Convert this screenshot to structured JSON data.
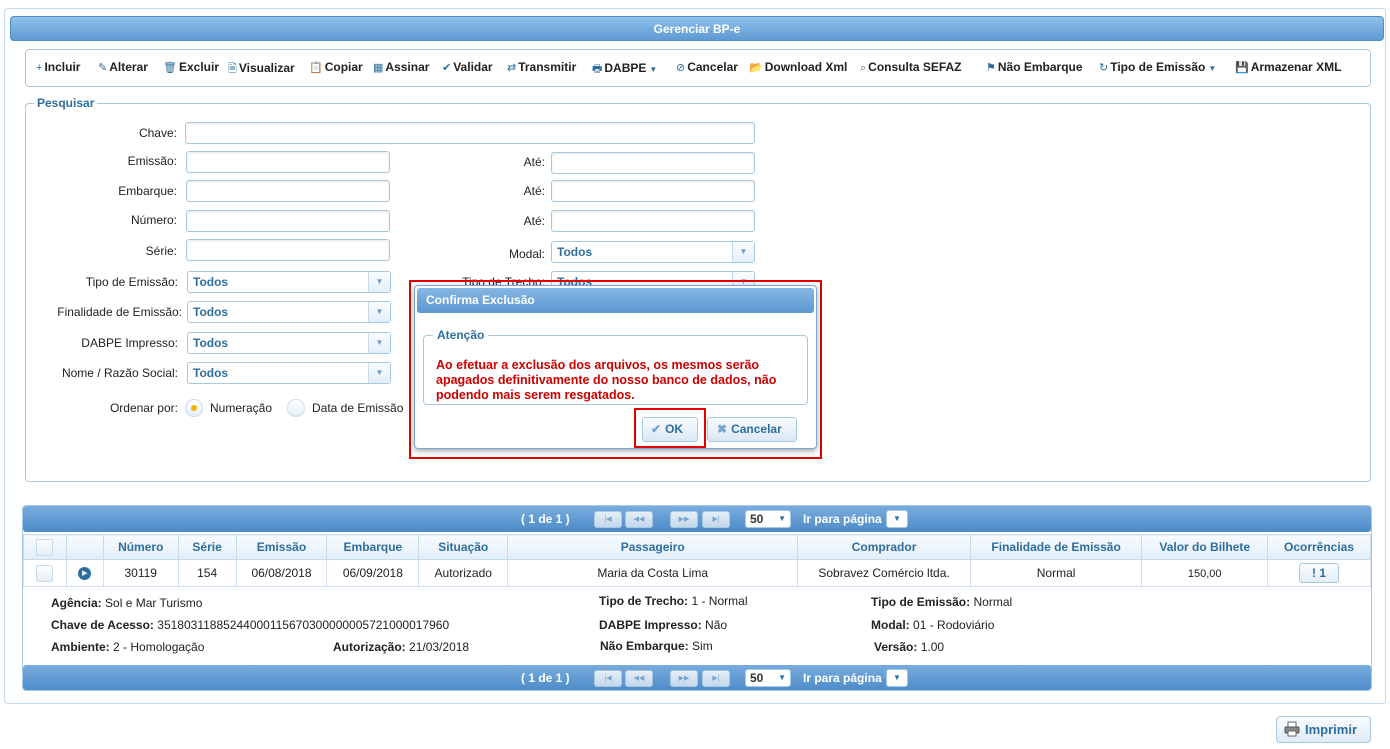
{
  "window": {
    "title": "Gerenciar BP-e"
  },
  "toolbar": {
    "items": [
      {
        "label": "Incluir",
        "icon": "+"
      },
      {
        "label": "Alterar",
        "icon": "✎"
      },
      {
        "label": "Excluir",
        "icon": "🗑"
      },
      {
        "label": "Visualizar",
        "icon": "🗎"
      },
      {
        "label": "Copiar",
        "icon": "📋"
      },
      {
        "label": "Assinar",
        "icon": "▦"
      },
      {
        "label": "Validar",
        "icon": "✔"
      },
      {
        "label": "Transmitir",
        "icon": "⇄"
      },
      {
        "label": "DABPE",
        "icon": "🖶"
      },
      {
        "label": "Cancelar",
        "icon": "⊘"
      },
      {
        "label": "Download Xml",
        "icon": "📂"
      },
      {
        "label": "Consulta SEFAZ",
        "icon": "⌕"
      },
      {
        "label": "Não Embarque",
        "icon": "⚑"
      },
      {
        "label": "Tipo de Emissão",
        "icon": "↻"
      },
      {
        "label": "Armazenar XML",
        "icon": "💾"
      }
    ]
  },
  "search": {
    "legend": "Pesquisar",
    "labels": {
      "chave": "Chave:",
      "emissao": "Emissão:",
      "ate": "Até:",
      "embarque": "Embarque:",
      "numero": "Número:",
      "serie": "Série:",
      "modal": "Modal:",
      "tipo_emissao": "Tipo de Emissão:",
      "tipo_trecho": "Tipo de Trecho:",
      "finalidade": "Finalidade de Emissão:",
      "dabpe_impresso": "DABPE Impresso:",
      "nome": "Nome / Razão Social:",
      "ordenar": "Ordenar por:"
    },
    "values": {
      "modal": "Todos",
      "tipo_emissao": "Todos",
      "tipo_trecho": "Todos",
      "finalidade": "Todos",
      "dabpe_impresso": "Todos",
      "nome": "Todos"
    },
    "order_options": {
      "numeracao": "Numeração",
      "data_emissao": "Data de Emissão"
    }
  },
  "pager": {
    "page_info": "( 1 de 1 )",
    "page_size": "50",
    "goto_label": "Ir para página"
  },
  "grid": {
    "columns": [
      "Número",
      "Série",
      "Emissão",
      "Embarque",
      "Situação",
      "Passageiro",
      "Comprador",
      "Finalidade de Emissão",
      "Valor do Bilhete",
      "Ocorrências"
    ],
    "row": {
      "numero": "30119",
      "serie": "154",
      "emissao": "06/08/2018",
      "embarque": "06/09/2018",
      "situacao": "Autorizado",
      "passageiro": "Maria da Costa Lima",
      "comprador": "Sobravez Comércio ltda.",
      "finalidade": "Normal",
      "valor": "150,00",
      "ocorrencias": "1"
    },
    "detail": {
      "agencia_label": "Agência:",
      "agencia": "Sol e Mar Turismo",
      "tipo_trecho_label": "Tipo de Trecho:",
      "tipo_trecho": "1 - Normal",
      "tipo_emissao_label": "Tipo de Emissão:",
      "tipo_emissao": "Normal",
      "chave_label": "Chave de Acesso:",
      "chave": "35180311885244000115670300000005721000017960",
      "dabpe_label": "DABPE Impresso:",
      "dabpe": "Não",
      "modal_label": "Modal:",
      "modal": "01 - Rodoviário",
      "ambiente_label": "Ambiente:",
      "ambiente": "2 - Homologação",
      "autorizacao_label": "Autorização:",
      "autorizacao": "21/03/2018",
      "nao_embarque_label": "Não Embarque:",
      "nao_embarque": "Sim",
      "versao_label": "Versão:",
      "versao": "1.00"
    }
  },
  "print": {
    "label": "Imprimir"
  },
  "dialog": {
    "title": "Confirma Exclusão",
    "legend": "Atenção",
    "message": "Ao efetuar a exclusão dos arquivos, os mesmos serão apagados definitivamente do nosso banco de dados, não podendo mais serem resgatados.",
    "ok_label": "OK",
    "cancel_label": "Cancelar"
  },
  "colors": {
    "accent": "#2e6e9e",
    "header": "#5e9ad2",
    "warning": "#cc0000",
    "highlight": "#e00000"
  }
}
